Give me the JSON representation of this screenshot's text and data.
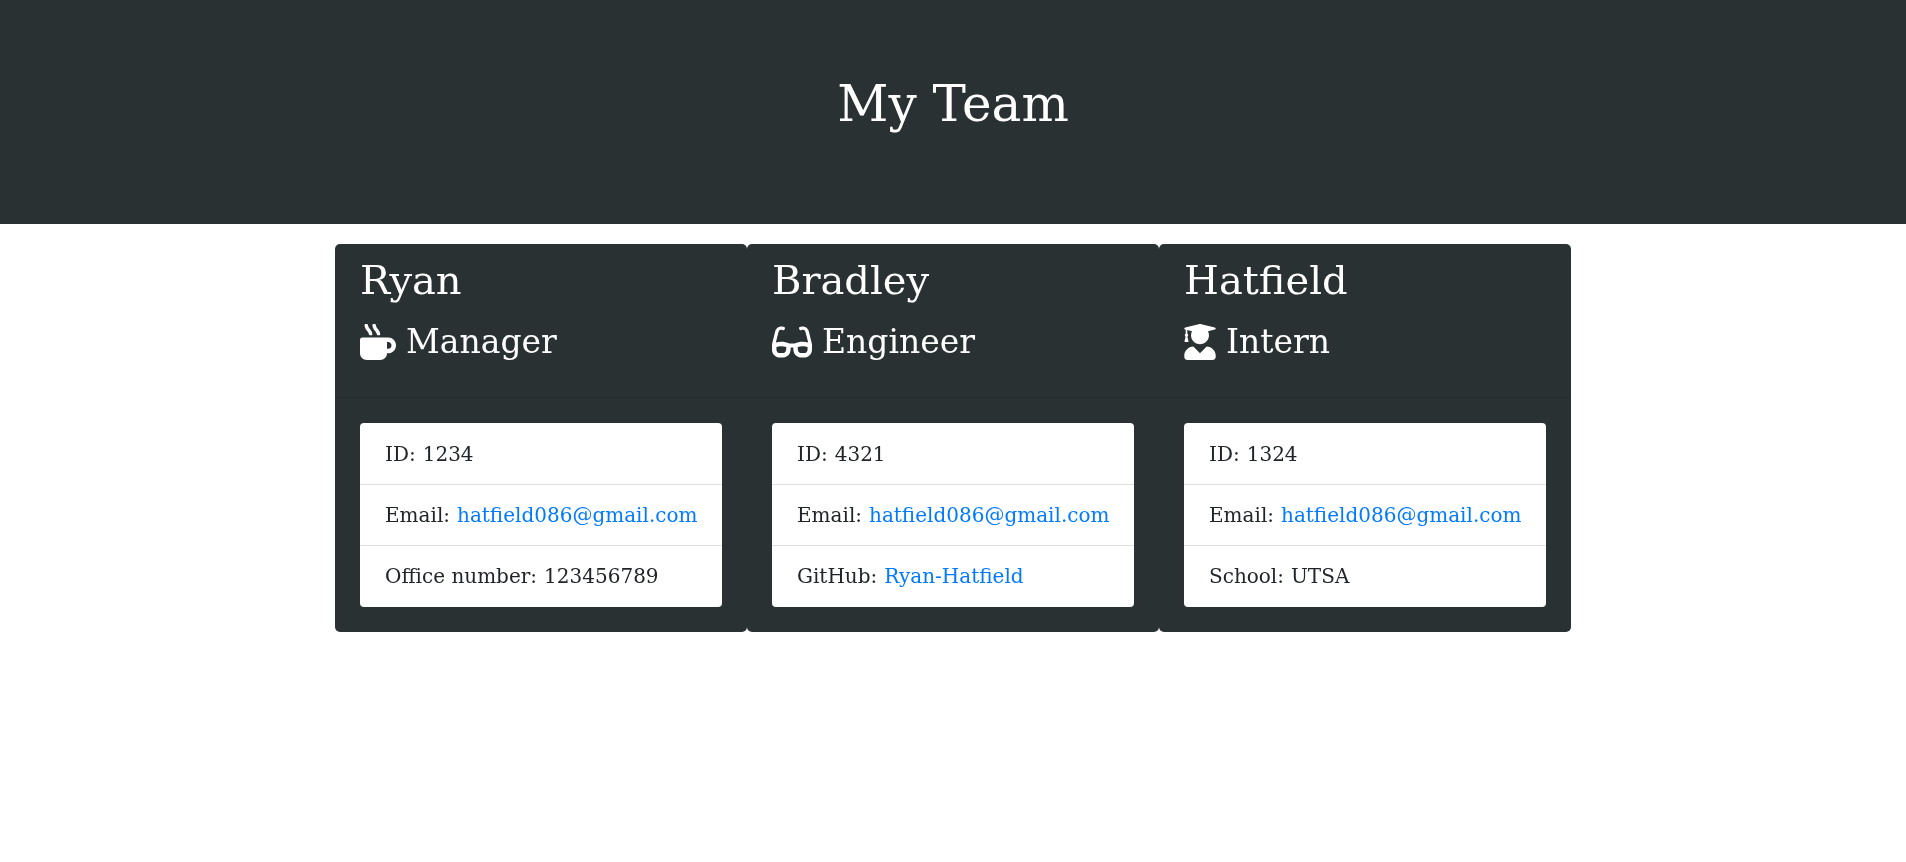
{
  "header": {
    "title": "My Team"
  },
  "cards": [
    {
      "kind": "manager",
      "name": "Ryan",
      "role": "Manager",
      "fields": [
        {
          "kind": "text",
          "label": "ID:",
          "value": "1234"
        },
        {
          "kind": "email",
          "label": "Email:",
          "value": "hatfield086@gmail.com"
        },
        {
          "kind": "text",
          "label": "Office number:",
          "value": "123456789"
        }
      ]
    },
    {
      "kind": "engineer",
      "name": "Bradley",
      "role": "Engineer",
      "fields": [
        {
          "kind": "text",
          "label": "ID:",
          "value": "4321"
        },
        {
          "kind": "email",
          "label": "Email:",
          "value": "hatfield086@gmail.com"
        },
        {
          "kind": "github",
          "label": "GitHub:",
          "value": "Ryan-Hatfield"
        }
      ]
    },
    {
      "kind": "intern",
      "name": "Hatfield",
      "role": "Intern",
      "fields": [
        {
          "kind": "text",
          "label": "ID:",
          "value": "1324"
        },
        {
          "kind": "email",
          "label": "Email:",
          "value": "hatfield086@gmail.com"
        },
        {
          "kind": "text",
          "label": "School:",
          "value": "UTSA"
        }
      ]
    }
  ]
}
